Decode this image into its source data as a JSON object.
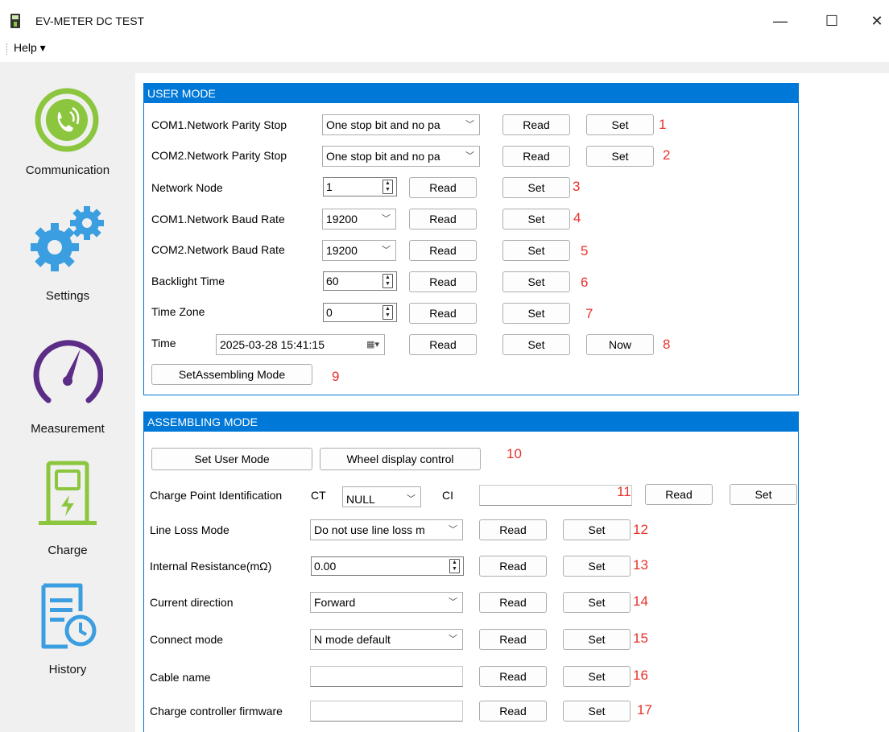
{
  "window": {
    "title": "EV-METER DC TEST",
    "minimize": "—",
    "maximize": "☐",
    "close": "✕"
  },
  "menu": {
    "help": "Help ▾"
  },
  "sidebar": {
    "items": [
      {
        "label": "Communication",
        "icon": "phone-signal-icon"
      },
      {
        "label": "Settings",
        "icon": "gears-icon"
      },
      {
        "label": "Measurement",
        "icon": "gauge-icon"
      },
      {
        "label": "Charge",
        "icon": "charger-icon"
      },
      {
        "label": "History",
        "icon": "history-doc-icon"
      }
    ]
  },
  "user_mode": {
    "title": "USER MODE",
    "rows": {
      "com1_parity": {
        "label": "COM1.Network Parity Stop",
        "value": "One stop bit and no pa",
        "read": "Read",
        "set": "Set",
        "num": "1"
      },
      "com2_parity": {
        "label": "COM2.Network Parity Stop",
        "value": "One stop bit and no pa",
        "read": "Read",
        "set": "Set",
        "num": "2"
      },
      "network_node": {
        "label": "Network Node",
        "value": "1",
        "read": "Read",
        "set": "Set",
        "num": "3"
      },
      "com1_baud": {
        "label": "COM1.Network Baud Rate",
        "value": "19200",
        "read": "Read",
        "set": "Set",
        "num": "4"
      },
      "com2_baud": {
        "label": "COM2.Network Baud Rate",
        "value": "19200",
        "read": "Read",
        "set": "Set",
        "num": "5"
      },
      "backlight": {
        "label": "Backlight Time",
        "value": "60",
        "read": "Read",
        "set": "Set",
        "num": "6"
      },
      "timezone": {
        "label": "Time Zone",
        "value": "0",
        "read": "Read",
        "set": "Set",
        "num": "7"
      },
      "time": {
        "label": "Time",
        "value": "2025-03-28 15:41:15",
        "read": "Read",
        "set": "Set",
        "now": "Now",
        "num": "8"
      }
    },
    "assembling_button": "SetAssembling Mode",
    "assembling_num": "9"
  },
  "assembling_mode": {
    "title": "ASSEMBLING MODE",
    "set_user_mode": "Set User Mode",
    "wheel_display": "Wheel display control",
    "buttons_num": "10",
    "rows": {
      "charge_point": {
        "label": "Charge Point Identification",
        "ct_label": "CT",
        "ct_value": "NULL",
        "ci_label": "CI",
        "ci_value": "",
        "read": "Read",
        "set": "Set",
        "num": "11"
      },
      "line_loss": {
        "label": "Line Loss Mode",
        "value": "Do not use line loss m",
        "read": "Read",
        "set": "Set",
        "num": "12"
      },
      "internal_resistance": {
        "label": "Internal Resistance(mΩ)",
        "value": "0.00",
        "read": "Read",
        "set": "Set",
        "num": "13"
      },
      "current_direction": {
        "label": "Current direction",
        "value": "Forward",
        "read": "Read",
        "set": "Set",
        "num": "14"
      },
      "connect_mode": {
        "label": "Connect mode",
        "value": "N mode default",
        "read": "Read",
        "set": "Set",
        "num": "15"
      },
      "cable_name": {
        "label": "Cable name",
        "value": "",
        "read": "Read",
        "set": "Set",
        "num": "16"
      },
      "firmware": {
        "label": "Charge controller firmware",
        "value": "",
        "read": "Read",
        "set": "Set",
        "num": "17"
      }
    }
  },
  "colors": {
    "accent": "#0078d7",
    "annotation": "#e8322b",
    "sidebar_bg": "#f0f0f0",
    "icon_green": "#8cc63f",
    "icon_blue": "#3a9ee0",
    "icon_purple": "#5b2d86"
  }
}
